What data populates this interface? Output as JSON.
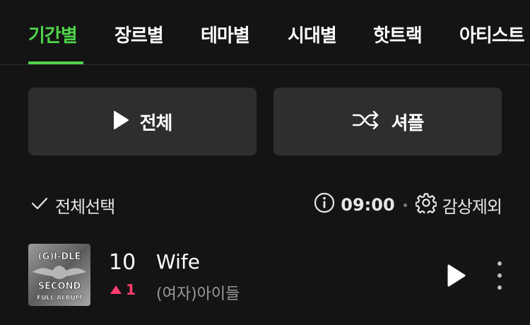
{
  "tabs": [
    "기간별",
    "장르별",
    "테마별",
    "시대별",
    "핫트랙",
    "아티스트"
  ],
  "active_tab": "기간별",
  "buttons": {
    "play_all": "전체",
    "shuffle": "셔플"
  },
  "toolbar": {
    "select_all": "전체선택",
    "timer": "09:00",
    "exclude": "감상제외"
  },
  "track": {
    "rank": "10",
    "rank_change": "1",
    "rank_direction": "up",
    "title": "Wife",
    "artist": "(여자)아이들",
    "cover_text": {
      "group": "(G)I-DLE",
      "album_line1": "SECOND",
      "album_line2": "FULL ALBUM"
    }
  },
  "colors": {
    "accent": "#4fd34a",
    "rank_up": "#ff3d6e",
    "background": "#141414",
    "button_bg": "#2e2e2e"
  }
}
